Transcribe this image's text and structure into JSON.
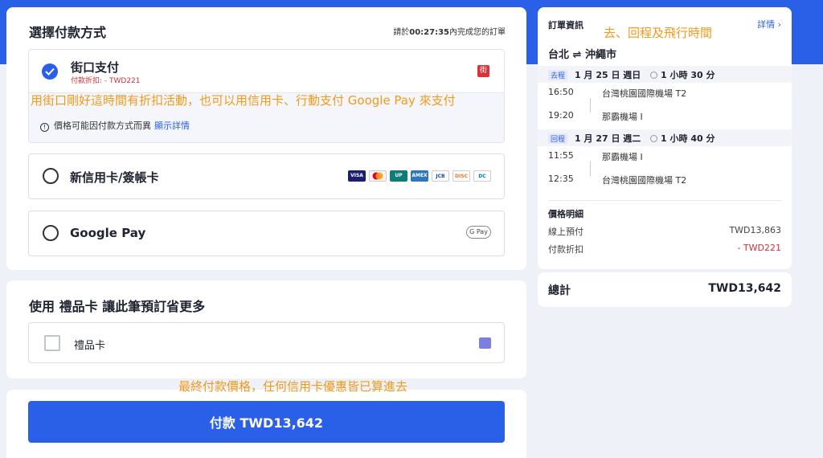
{
  "payment": {
    "title": "選擇付款方式",
    "deadline_prefix": "請於",
    "deadline_time": "00:27:35",
    "deadline_suffix": "內完成您的訂單",
    "options": [
      {
        "name": "街口支付",
        "discount": "付款折扣: - TWD221",
        "logo": "街",
        "selected": true
      },
      {
        "name": "新信用卡/簽帳卡",
        "selected": false
      },
      {
        "name": "Google Pay",
        "badge": "G Pay",
        "selected": false
      }
    ],
    "price_note": "價格可能因付款方式而異",
    "show_details": "顯示詳情",
    "card_logos": [
      "VISA",
      "MC",
      "UP",
      "AMEX",
      "JCB",
      "DISC",
      "DC"
    ]
  },
  "gift": {
    "title": "使用 禮品卡 讓此筆預訂省更多",
    "label": "禮品卡"
  },
  "pay_button": "付款 TWD13,642",
  "summary": {
    "title": "訂單資訊",
    "details_link": "詳情 ›",
    "route": "台北 ⇌ 沖繩市",
    "legs": [
      {
        "tag": "去程",
        "date": "1 月 25 日 週日",
        "duration": "1 小時 30 分",
        "dep_time": "16:50",
        "dep_airport": "台灣桃園國際機場 T2",
        "arr_time": "19:20",
        "arr_airport": "那霸機場 I"
      },
      {
        "tag": "回程",
        "date": "1 月 27 日 週二",
        "duration": "1 小時 40 分",
        "dep_time": "11:55",
        "dep_airport": "那霸機場 I",
        "arr_time": "12:35",
        "arr_airport": "台灣桃園國際機場 T2"
      }
    ],
    "price_title": "價格明細",
    "online_label": "線上預付",
    "online_value": "TWD13,863",
    "discount_label": "付款折扣",
    "discount_value": "- TWD221",
    "total_label": "總計",
    "total_value": "TWD13,642"
  },
  "annotations": {
    "flight": "去、回程及飛行時間",
    "jiekou": "用街口剛好這時間有折扣活動，也可以用信用卡、行動支付 Google Pay 來支付",
    "final": "最終付款價格，任何信用卡優惠皆已算進去"
  },
  "colors": {
    "accent": "#2a5fe8",
    "annotation": "#f29a1b",
    "discount": "#d2313a"
  }
}
